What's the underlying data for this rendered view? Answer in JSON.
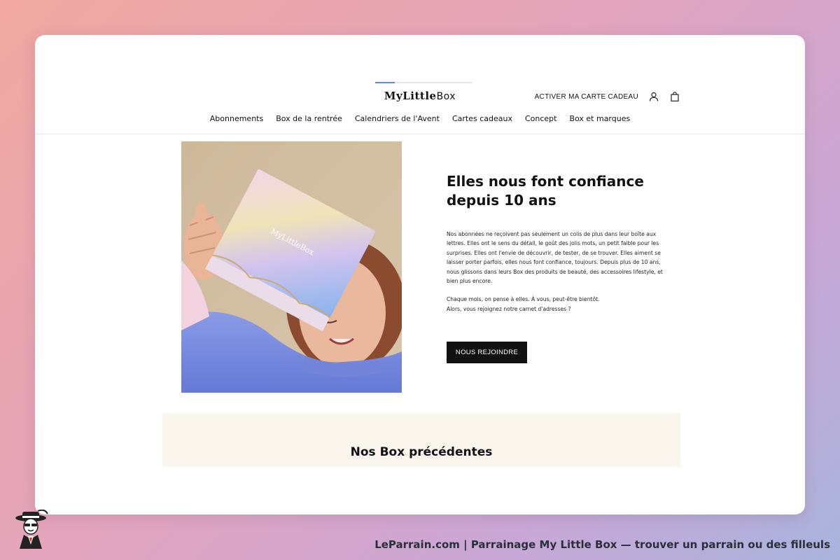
{
  "header": {
    "logo": {
      "part1": "MyLittle",
      "part2": "Box"
    },
    "gift_card_link": "ACTIVER MA CARTE CADEAU",
    "icons": [
      "user-icon",
      "shopping-bag-icon"
    ]
  },
  "nav": {
    "items": [
      "Abonnements",
      "Box de la rentrée",
      "Calendriers de l'Avent",
      "Cartes cadeaux",
      "Concept",
      "Box et marques"
    ]
  },
  "hero": {
    "title_line1": "Elles nous font confiance",
    "title_line2": "depuis 10 ans",
    "paragraph1": "Nos abonnées ne reçoivent pas seulement un colis de plus dans leur boîte aux lettres. Elles ont le sens du détail, le goût des jolis mots, un petit faible pour les surprises. Elles ont l'envie de découvrir, de tester, de se trouver. Elles aiment se laisser porter parfois, elles nous font confiance, toujours. Depuis plus de 10 ans, nous glissons dans leurs Box des produits de beauté, des accessoires lifestyle, et bien plus encore.",
    "paragraph2_line1": "Chaque mois, on pense à elles. À vous, peut-être bientôt.",
    "paragraph2_line2": "Alors, vous rejoignez notre carnet d'adresses ?",
    "cta": "NOUS REJOINDRE",
    "box_print": "MyLittleBox"
  },
  "previous": {
    "title": "Nos Box précédentes"
  },
  "watermark": {
    "caption": "LeParrain.com | Parrainage My Little Box — trouver un parrain ou des filleuls"
  },
  "colors": {
    "accent_blue": "#5b8def",
    "button_black": "#111111",
    "section_cream": "#faf6ee",
    "sweater_blue": "#6f86de"
  }
}
